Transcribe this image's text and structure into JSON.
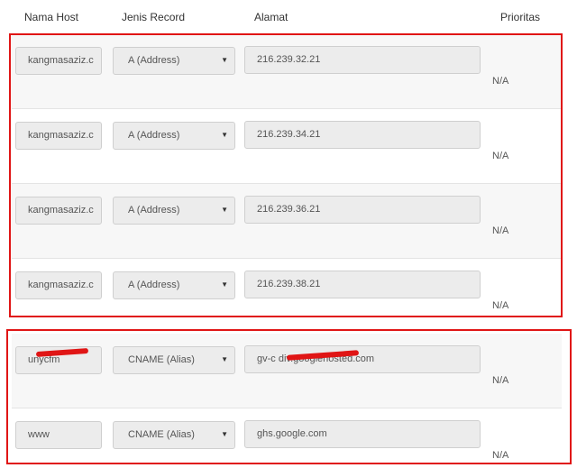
{
  "headers": {
    "host": "Nama Host",
    "type": "Jenis Record",
    "address": "Alamat",
    "priority": "Prioritas"
  },
  "rows": [
    {
      "host": "kangmasaziz.c",
      "type": "A (Address)",
      "address": "216.239.32.21",
      "priority": "N/A"
    },
    {
      "host": "kangmasaziz.c",
      "type": "A (Address)",
      "address": "216.239.34.21",
      "priority": "N/A"
    },
    {
      "host": "kangmasaziz.c",
      "type": "A (Address)",
      "address": "216.239.36.21",
      "priority": "N/A"
    },
    {
      "host": "kangmasaziz.c",
      "type": "A (Address)",
      "address": "216.239.38.21",
      "priority": "N/A"
    },
    {
      "host": "unycfm",
      "type": "CNAME (Alias)",
      "address": "gv-c                     div.googlehosted.com",
      "priority": "N/A"
    },
    {
      "host": "www",
      "type": "CNAME (Alias)",
      "address": "ghs.google.com",
      "priority": "N/A"
    }
  ],
  "icons": {
    "dropdown": "chevron-down-icon"
  },
  "colors": {
    "highlight": "#e01515",
    "field_bg": "#ececec",
    "row_alt": "#f7f7f7"
  }
}
